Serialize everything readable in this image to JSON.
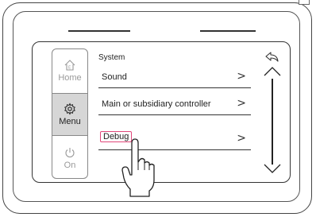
{
  "sidebar": {
    "items": [
      {
        "label": "Home",
        "icon": "home-icon",
        "active": false
      },
      {
        "label": "Menu",
        "icon": "gear-icon",
        "active": true
      },
      {
        "label": "On",
        "icon": "power-icon",
        "active": false
      }
    ]
  },
  "panel": {
    "title": "System",
    "rows": [
      {
        "label": "Sound",
        "chevron": ">"
      },
      {
        "label": "Main or subsidiary controller",
        "chevron": ">"
      },
      {
        "label": "Debug",
        "chevron": ">",
        "highlighted": true
      }
    ]
  },
  "colors": {
    "highlight": "#e0477a",
    "active_bg": "#d6d6d6"
  }
}
